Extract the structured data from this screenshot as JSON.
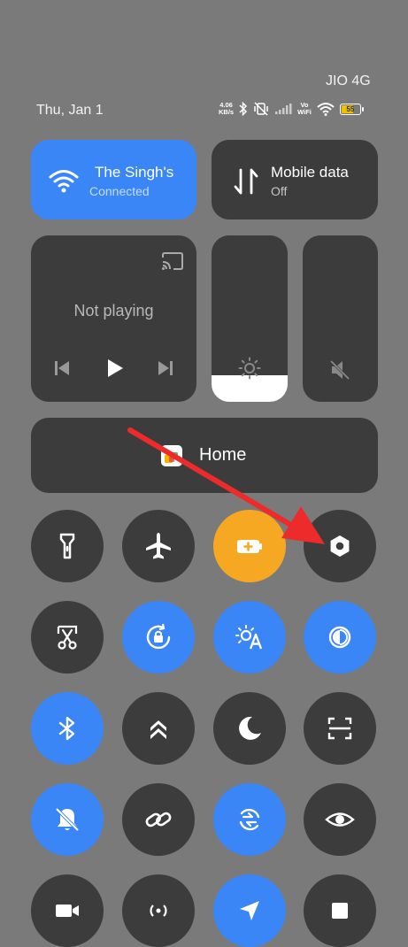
{
  "status_bar": {
    "carrier": "JIO 4G",
    "date": "Thu, Jan 1",
    "net_speed_value": "4.06",
    "net_speed_unit": "KB/s",
    "vowifi_top": "Vo",
    "vowifi_bottom": "WiFi",
    "battery_level": "55"
  },
  "wifi_tile": {
    "title": "The Singh's",
    "subtitle": "Connected",
    "icon": "wifi-icon",
    "state": "on"
  },
  "mobile_data_tile": {
    "title": "Mobile data",
    "subtitle": "Off",
    "icon": "mobile-data-arrows-icon",
    "state": "off"
  },
  "media": {
    "status": "Not playing",
    "icons": [
      "cast-icon",
      "previous-icon",
      "play-icon",
      "next-icon"
    ]
  },
  "brightness": {
    "level_percent": 16,
    "icon": "sun-icon"
  },
  "volume": {
    "muted": true,
    "icon": "volume-mute-icon"
  },
  "home_tile": {
    "label": "Home",
    "icon": "smart-home-icon"
  },
  "toggles": [
    {
      "name": "flashlight",
      "icon": "flashlight-icon",
      "state": "off"
    },
    {
      "name": "airplane-mode",
      "icon": "airplane-icon",
      "state": "off"
    },
    {
      "name": "battery-saver",
      "icon": "battery-saver-icon",
      "state": "on-amber"
    },
    {
      "name": "settings",
      "icon": "settings-hexagon-icon",
      "state": "off"
    },
    {
      "name": "screenshot",
      "icon": "scissors-icon",
      "state": "off"
    },
    {
      "name": "auto-rotate",
      "icon": "rotation-lock-icon",
      "state": "on"
    },
    {
      "name": "auto-brightness",
      "icon": "auto-brightness-icon",
      "state": "on"
    },
    {
      "name": "dark-mode",
      "icon": "contrast-icon",
      "state": "on"
    },
    {
      "name": "bluetooth",
      "icon": "bluetooth-icon",
      "state": "on"
    },
    {
      "name": "data-saver",
      "icon": "double-chevron-up-icon",
      "state": "off"
    },
    {
      "name": "do-not-disturb",
      "icon": "moon-icon",
      "state": "off"
    },
    {
      "name": "scanner",
      "icon": "scan-frame-icon",
      "state": "off"
    },
    {
      "name": "mute",
      "icon": "bell-off-icon",
      "state": "on"
    },
    {
      "name": "link-sharing",
      "icon": "link-icon",
      "state": "off"
    },
    {
      "name": "sync",
      "icon": "sync-icon",
      "state": "on"
    },
    {
      "name": "reading-mode",
      "icon": "eye-icon",
      "state": "off"
    }
  ],
  "colors": {
    "background": "#7a7a7a",
    "tile": "#3c3c3c",
    "accent_blue": "#3a86f7",
    "accent_amber": "#f7a823",
    "annotation_arrow": "#ee2b2b"
  }
}
